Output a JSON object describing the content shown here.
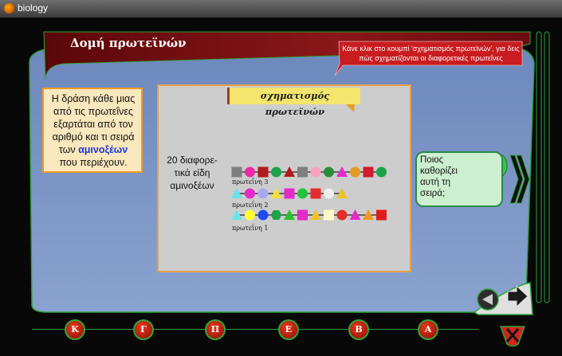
{
  "window": {
    "title": "biology"
  },
  "header": {
    "title": "Δομή πρωτεϊνών"
  },
  "tip": {
    "text": "Κάνε κλικ στο κουμπί 'σχηματισμός πρωτεϊνών', για δεις πώς σχηματίζονται οι διαφορετικές πρωτεΐνες"
  },
  "info": {
    "text_before": "Η δράση κάθε μιας από τις πρωτεΐνες εξαρτάται από τον αριθμό και τι σειρά των ",
    "link": "αμινοξέων",
    "text_after": " που περιέχουν."
  },
  "panel": {
    "button_label": "σχηματισμός πρωτεϊνών",
    "bag_label": "20 διαφορε- τικά είδη αμινοξέων",
    "proteins": [
      {
        "label": "πρωτεΐνη 3",
        "chain": [
          "square:#7f7f7f",
          "circle:#ec2aa6",
          "square:#b01c1c",
          "circle:#1ea24c",
          "triangle:#b01c1c",
          "square:#7f7f7f",
          "circle:#f7a2c0",
          "circle:#2b8c3e",
          "triangle:#e42ac8",
          "circle:#e09b22",
          "square:#d21b2c",
          "circle:#1ea24c"
        ]
      },
      {
        "label": "πρωτεΐνη 2",
        "chain": [
          "triangle:#6be3e8",
          "circle:#e42ac8",
          "circle:#a7a8ee",
          "triangle:#f0e23a",
          "square:#e42ac8",
          "circle:#25c13e",
          "square:#e32d2d",
          "circle:#eeeeee",
          "triangle:#f0c22a"
        ]
      },
      {
        "label": "πρωτεΐνη 1",
        "chain": [
          "triangle:#6be3e8",
          "circle:#ffff33",
          "circle:#1f49f1",
          "hexagon:#1ea24c",
          "triangle:#2cbf2c",
          "square:#e42ac8",
          "triangle:#f0c22a",
          "square:#fff8c8",
          "circle:#e32d2d",
          "triangle:#e42ac8",
          "triangle:#f09a20",
          "square:#e31a1a"
        ]
      }
    ]
  },
  "question": {
    "text": "Ποιος καθορίζει αυτή τη σειρά;"
  },
  "nav": {
    "buttons": [
      "Κ",
      "Γ",
      "Π",
      "Ε",
      "Β",
      "Α"
    ]
  },
  "colors": {
    "background_blue": "#7e96c8",
    "header_red": "#7a1114",
    "frame_green": "#2da23a",
    "button_red": "#c9241c"
  }
}
